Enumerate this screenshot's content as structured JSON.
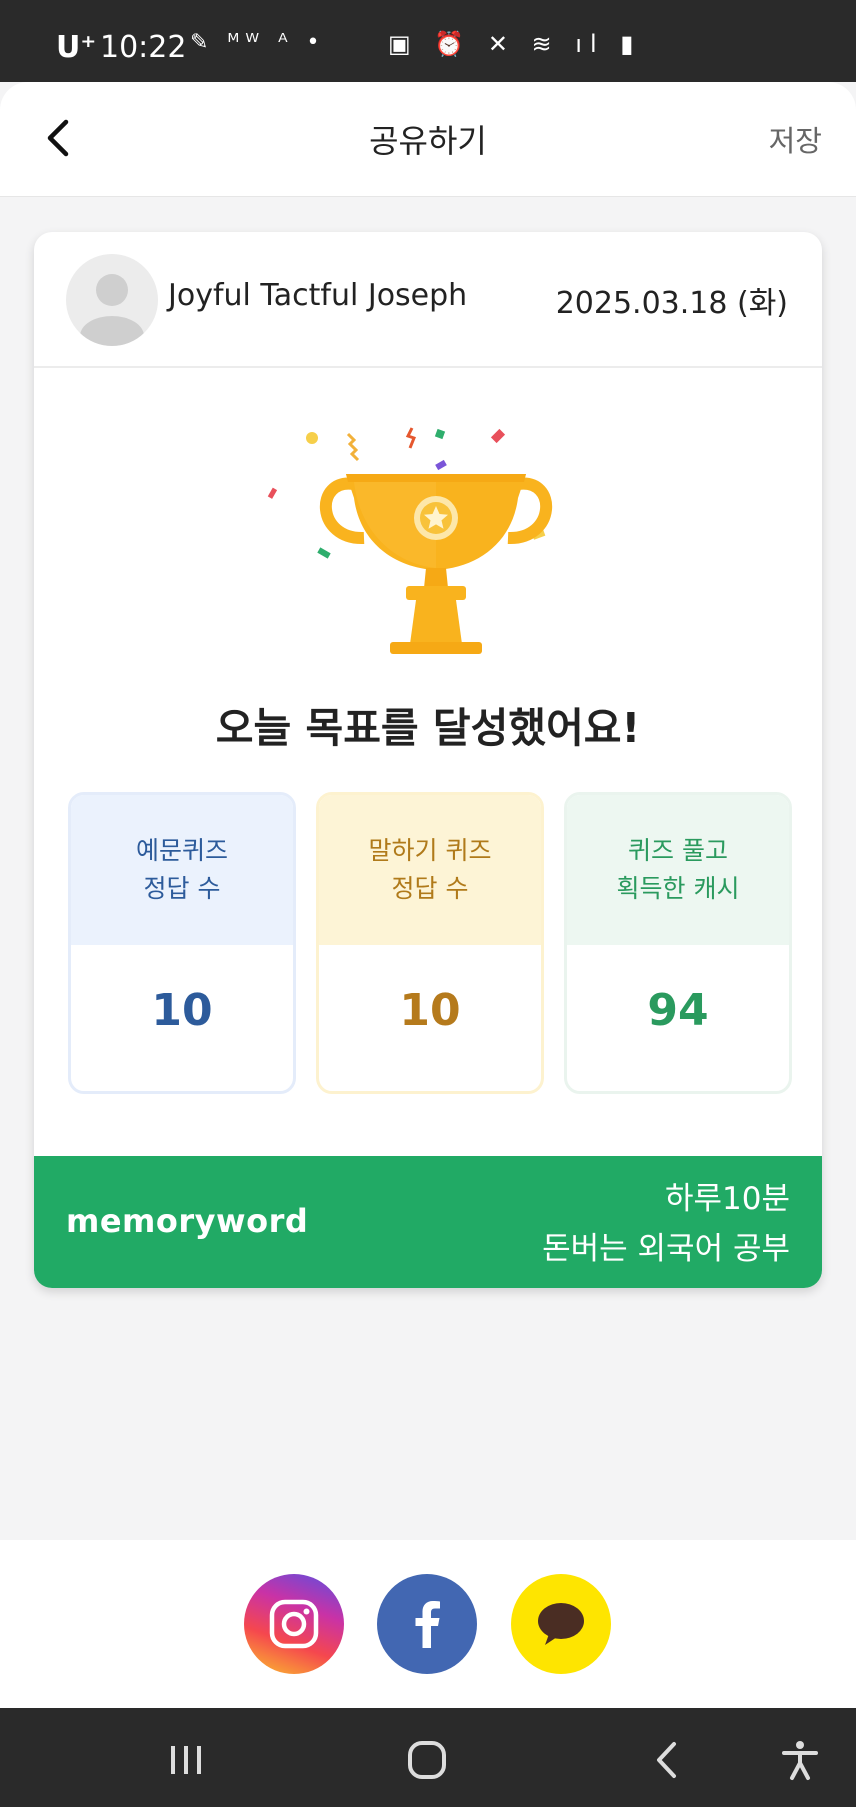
{
  "status_bar": {
    "carrier": "U⁺",
    "time": "10:22",
    "left_icons": "✎ ᴹᵂ ᴬ •",
    "right_icons": "▣ ⏰ ✕ ≋ ıl ▮"
  },
  "app_bar": {
    "title": "공유하기",
    "save_label": "저장"
  },
  "card": {
    "user_name": "Joyful Tactful Joseph",
    "date": "2025.03.18 (화)",
    "headline": "오늘 목표를 달성했어요!",
    "stats": [
      {
        "label_line1": "예문퀴즈",
        "label_line2": "정답 수",
        "value": "10"
      },
      {
        "label_line1": "말하기 퀴즈",
        "label_line2": "정답 수",
        "value": "10"
      },
      {
        "label_line1": "퀴즈 풀고",
        "label_line2": "획득한 캐시",
        "value": "94"
      }
    ],
    "brand": {
      "name": "memoryword",
      "slogan_line1": "하루10분",
      "slogan_line2": "돈버는 외국어 공부"
    }
  },
  "colors": {
    "brand_green": "#21aa65",
    "trophy_gold": "#f9b31e",
    "stat_blue": "#2d5b9b",
    "stat_orange": "#b57a1c",
    "stat_green": "#2a9a5e",
    "facebook_blue": "#4267b2",
    "kakao_yellow": "#fee500"
  },
  "icons": {
    "back": "chevron-left-icon",
    "trophy": "trophy-icon",
    "share_instagram": "instagram-icon",
    "share_facebook": "facebook-icon",
    "share_kakao": "kakaotalk-icon",
    "nav_recents": "recent-apps-icon",
    "nav_home": "home-icon",
    "nav_back": "back-icon",
    "nav_accessibility": "accessibility-icon"
  }
}
